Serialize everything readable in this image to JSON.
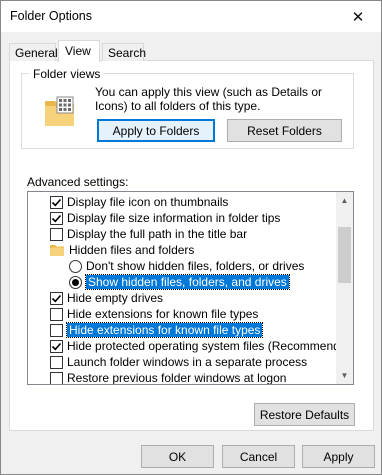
{
  "window": {
    "title": "Folder Options"
  },
  "tabs": [
    {
      "label": "General",
      "active": false
    },
    {
      "label": "View",
      "active": true
    },
    {
      "label": "Search",
      "active": false
    }
  ],
  "folder_views": {
    "label": "Folder views",
    "description": "You can apply this view (such as Details or Icons) to all folders of this type.",
    "apply_button": "Apply to Folders",
    "reset_button": "Reset Folders"
  },
  "advanced": {
    "label": "Advanced settings:",
    "items": [
      {
        "type": "checkbox",
        "checked": true,
        "label": "Display file icon on thumbnails"
      },
      {
        "type": "checkbox",
        "checked": true,
        "label": "Display file size information in folder tips"
      },
      {
        "type": "checkbox",
        "checked": false,
        "label": "Display the full path in the title bar"
      },
      {
        "type": "folder",
        "label": "Hidden files and folders"
      },
      {
        "type": "radio",
        "checked": false,
        "label": "Don't show hidden files, folders, or drives"
      },
      {
        "type": "radio",
        "checked": true,
        "label": "Show hidden files, folders, and drives",
        "highlighted": true
      },
      {
        "type": "checkbox",
        "checked": true,
        "label": "Hide empty drives"
      },
      {
        "type": "checkbox",
        "checked": false,
        "label": "Hide extensions for known file types"
      },
      {
        "type": "checkbox",
        "checked": false,
        "label": "Hide extensions for known file types",
        "highlighted": true
      },
      {
        "type": "checkbox",
        "checked": true,
        "label": "Hide protected operating system files (Recommended)"
      },
      {
        "type": "checkbox",
        "checked": false,
        "label": "Launch folder windows in a separate process"
      },
      {
        "type": "checkbox",
        "checked": false,
        "label": "Restore previous folder windows at logon"
      }
    ],
    "restore_button": "Restore Defaults"
  },
  "footer": {
    "ok": "OK",
    "cancel": "Cancel",
    "apply": "Apply"
  },
  "colors": {
    "accent": "#0078d7",
    "window_bg": "#f0f0f0"
  }
}
